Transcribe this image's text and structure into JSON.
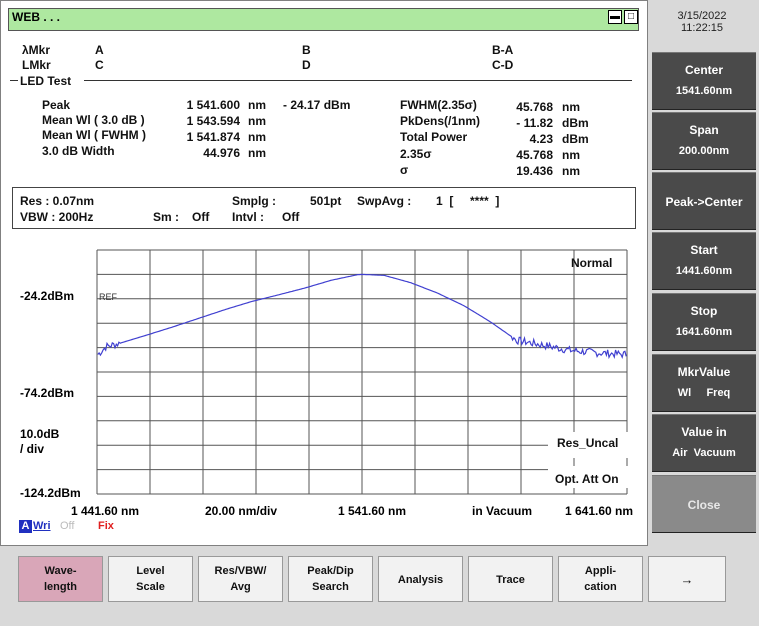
{
  "window": {
    "title": "WEB . . ."
  },
  "clock": {
    "date": "3/15/2022",
    "time": "11:22:15"
  },
  "markers": {
    "lambda_mkr": "λMkr",
    "l_mkr": "LMkr",
    "a": "A",
    "b": "B",
    "ba": "B-A",
    "c": "C",
    "d": "D",
    "cd": "C-D"
  },
  "led": {
    "section_title": "LED Test",
    "rows": [
      {
        "label": "Peak",
        "value": "1 541.600",
        "unit": "nm",
        "extra": "- 24.17 dBm"
      },
      {
        "label": "Mean Wl  ( 3.0  dB )",
        "value": "1 543.594",
        "unit": "nm",
        "extra": ""
      },
      {
        "label": "Mean Wl  ( FWHM )",
        "value": "1 541.874",
        "unit": "nm",
        "extra": ""
      },
      {
        "label": "3.0     dB Width",
        "value": "44.976",
        "unit": "nm",
        "extra": ""
      }
    ],
    "right_rows": [
      {
        "label": "FWHM(2.35σ)",
        "value": "45.768",
        "unit": "nm"
      },
      {
        "label": "PkDens(/1nm)",
        "value": "- 11.82",
        "unit": "dBm"
      },
      {
        "label": "Total Power",
        "value": "4.23",
        "unit": "dBm"
      },
      {
        "label": "2.35σ",
        "value": "45.768",
        "unit": "nm"
      },
      {
        "label": "σ",
        "value": "19.436",
        "unit": "nm"
      }
    ]
  },
  "settings": {
    "res": "Res :  0.07nm",
    "vbw": "VBW :  200Hz",
    "smplg_label": "Smplg :",
    "smplg_value": "501pt",
    "swpavg_label": "SwpAvg :",
    "swpavg_value": "1  [     ****  ]",
    "sm_label": "Sm :",
    "sm_value": "Off",
    "intvl_label": "Intvl :",
    "intvl_value": "Off"
  },
  "graph": {
    "mode": "Normal",
    "ref": "REF",
    "res_uncal": "Res_Uncal",
    "opt_att": "Opt. Att On",
    "y_top": "-24.2dBm",
    "y_mid": "-74.2dBm",
    "y_div": "10.0dB",
    "y_div2": "/ div",
    "y_bottom": "-124.2dBm",
    "x_start": "1 441.60 nm",
    "x_div": "20.00 nm/div",
    "x_center": "1 541.60 nm",
    "x_medium": "in Vacuum",
    "x_stop": "1 641.60 nm",
    "trace_a": "A",
    "trace_wri": "Wri",
    "trace_off": "Off",
    "trace_fix": "Fix",
    "trace_color": "#4040d0"
  },
  "chart_data": {
    "type": "line",
    "xlabel": "",
    "ylabel": "",
    "xlim": [
      1441.6,
      1641.6
    ],
    "ylim": [
      -124.2,
      -24.2
    ],
    "x": [
      1442,
      1445,
      1450,
      1460,
      1470,
      1480,
      1490,
      1500,
      1510,
      1520,
      1530,
      1540,
      1541.6,
      1550,
      1560,
      1570,
      1580,
      1590,
      1600,
      1610,
      1620,
      1630,
      1641
    ],
    "y": [
      -67,
      -63.8,
      -62.5,
      -59.2,
      -55.8,
      -52.2,
      -48.6,
      -45.3,
      -42.6,
      -39.8,
      -36.6,
      -34.3,
      -34.2,
      -34.6,
      -37.6,
      -41.8,
      -47,
      -53.6,
      -61.2,
      -63.2,
      -65.3,
      -66.3,
      -67
    ]
  },
  "softkeys": [
    {
      "l1": "Center",
      "l2": "1541.60nm"
    },
    {
      "l1": "Span",
      "l2": "200.00nm"
    },
    {
      "l1": "Peak->Center",
      "l2": ""
    },
    {
      "l1": "Start",
      "l2": "1441.60nm"
    },
    {
      "l1": "Stop",
      "l2": "1641.60nm"
    },
    {
      "l1": "MkrValue",
      "l2": "Wl     Freq"
    },
    {
      "l1": "Value in",
      "l2": "Air  Vacuum"
    },
    {
      "l1": "Close",
      "l2": ""
    }
  ],
  "fkeys": [
    {
      "l1": "Wave-",
      "l2": "length"
    },
    {
      "l1": "Level",
      "l2": "Scale"
    },
    {
      "l1": "Res/VBW/",
      "l2": "Avg"
    },
    {
      "l1": "Peak/Dip",
      "l2": "Search"
    },
    {
      "l1": "Analysis",
      "l2": ""
    },
    {
      "l1": "Trace",
      "l2": ""
    },
    {
      "l1": "Appli-",
      "l2": "cation"
    },
    {
      "l1": "→",
      "l2": ""
    }
  ]
}
